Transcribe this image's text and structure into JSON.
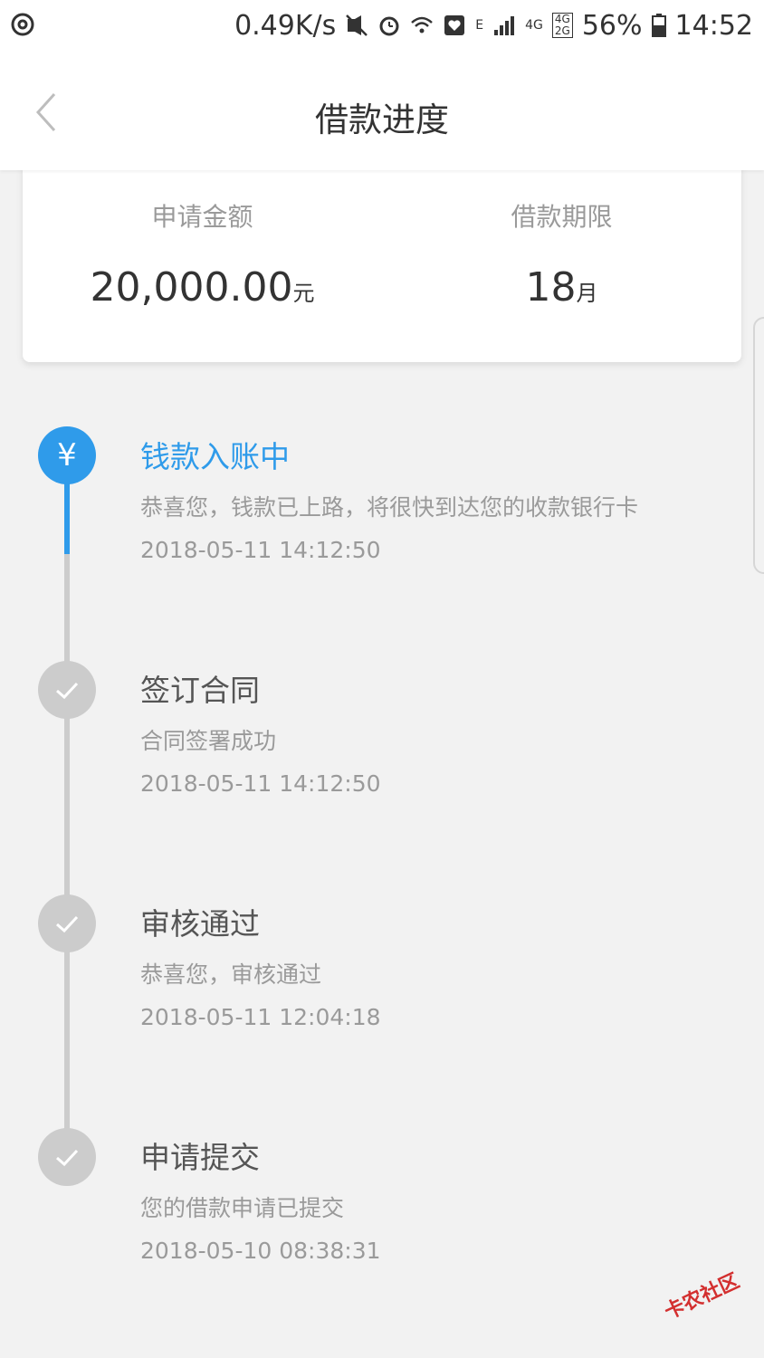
{
  "status_bar": {
    "net_speed": "0.49K/s",
    "network_e": "E",
    "network_4g": "4G",
    "dual_top": "4G",
    "dual_bottom": "2G",
    "battery": "56%",
    "time": "14:52"
  },
  "nav": {
    "title": "借款进度",
    "back_icon": "chevron-left-icon"
  },
  "summary": {
    "amount_label": "申请金额",
    "amount_value": "20,000.00",
    "amount_unit": "元",
    "term_label": "借款期限",
    "term_value": "18",
    "term_unit": "月"
  },
  "timeline": [
    {
      "title": "钱款入账中",
      "desc": "恭喜您，钱款已上路，将很快到达您的收款银行卡",
      "time": "2018-05-11 14:12:50",
      "icon": "yen-icon",
      "icon_text": "¥",
      "active": true
    },
    {
      "title": "签订合同",
      "desc": "合同签署成功",
      "time": "2018-05-11 14:12:50",
      "icon": "check-icon",
      "active": false
    },
    {
      "title": "审核通过",
      "desc": "恭喜您，审核通过",
      "time": "2018-05-11 12:04:18",
      "icon": "check-icon",
      "active": false
    },
    {
      "title": "申请提交",
      "desc": "您的借款申请已提交",
      "time": "2018-05-10 08:38:31",
      "icon": "check-icon",
      "active": false
    }
  ],
  "colors": {
    "accent": "#2f9bea",
    "inactive": "#cccccc",
    "background": "#f2f2f2"
  },
  "watermark": {
    "text": "卡农社区"
  }
}
